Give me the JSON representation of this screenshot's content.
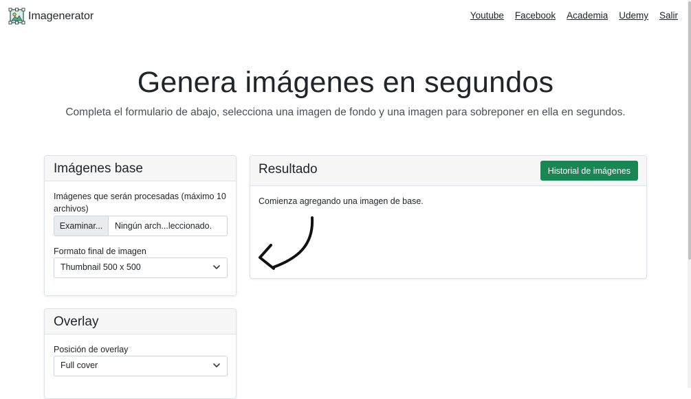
{
  "brand": {
    "name": "Imagenerator",
    "logo_icon": "image-generator-logo-icon"
  },
  "nav": {
    "links": [
      "Youtube",
      "Facebook",
      "Academia",
      "Udemy",
      "Salir"
    ]
  },
  "hero": {
    "title": "Genera imágenes en segundos",
    "subtitle": "Completa el formulario de abajo, selecciona una imagen de fondo y una imagen para sobreponer en ella en segundos."
  },
  "base_card": {
    "title": "Imágenes base",
    "files_label": "Imágenes que serán procesadas (máximo 10 archivos)",
    "browse_label": "Examinar...",
    "file_status": "Ningún arch...leccionado.",
    "format_label": "Formato final de imagen",
    "format_value": "Thumbnail 500 x 500"
  },
  "overlay_card": {
    "title": "Overlay",
    "position_label": "Posición de overlay",
    "position_value": "Full cover"
  },
  "result_card": {
    "title": "Resultado",
    "history_button": "Historial de imágenes",
    "empty_message": "Comienza agregando una imagen de base."
  },
  "colors": {
    "accent": "#198754",
    "text": "#212529",
    "header_bg": "#f7f7f7"
  }
}
